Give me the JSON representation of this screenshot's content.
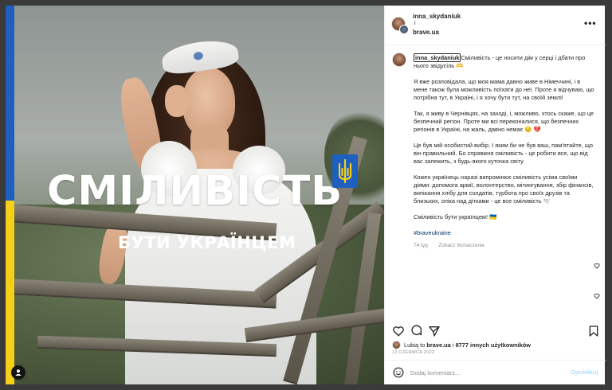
{
  "post_image": {
    "headline": "СМІЛИВІСТЬ",
    "subline": "БУТИ УКРАЇНЦЕМ",
    "flag_colors": {
      "blue": "#1f5fbf",
      "yellow": "#f6d018"
    }
  },
  "header": {
    "username": "inna_skydaniuk",
    "separator": "i",
    "collab_username": "brave.ua",
    "more_icon": "ellipsis-icon"
  },
  "caption": {
    "username": "inna_skydaniuk",
    "p1": "Сміливість - це носити дім у серці і дбати про нього звідусіль 🫶",
    "p2": "Я вже розповідала, що моя мама давно живе в Німеччині, і в мене також була можливість поїхати до неї. Проте я відчуваю, що потрібна тут, в Україні, і я хочу бути тут, на своїй землі!",
    "p3": "Так, я живу в Чернівцях, на заході, і, можливо, хтось скаже, що це безпечний регіон. Проте ми всі переконалися, що безпечних регіонів в Україні, на жаль, давно немає 😔 💔",
    "p4": "Це був мій особистий вибір. І яким би не був ваш, пам'ятайте, що він правильний. Бо справжня сміливість - це робити все, що від вас залежить, з будь-якого куточка світу.",
    "p5": "Кожен українець наразі випромінює сміливість усіма своїми діями: допомога армії, волонтерство, мітингування, збір фінансів, випікання хлібу для солдатів, турбота про своїх друзів та близьких, опіка над дітками - це все сміливість 🕊️",
    "p6": "Сміливість бути українцем! 🇺🇦",
    "hashtag": "#braveukraine",
    "age": "74 tyg.",
    "translate": "Zobacz tłumaczenie"
  },
  "likes": {
    "prefix": "Lubią to",
    "user": "brave.ua",
    "joiner": "i",
    "others": "8777 innych użytkowników"
  },
  "date": "12 CZERWCA 2022",
  "comment_box": {
    "placeholder": "Dodaj komentarz...",
    "post_label": "Opublikuj"
  },
  "colors": {
    "text": "#262626",
    "muted": "#8e8e8e",
    "link": "#00376b",
    "post_disabled": "#b2dffc"
  }
}
